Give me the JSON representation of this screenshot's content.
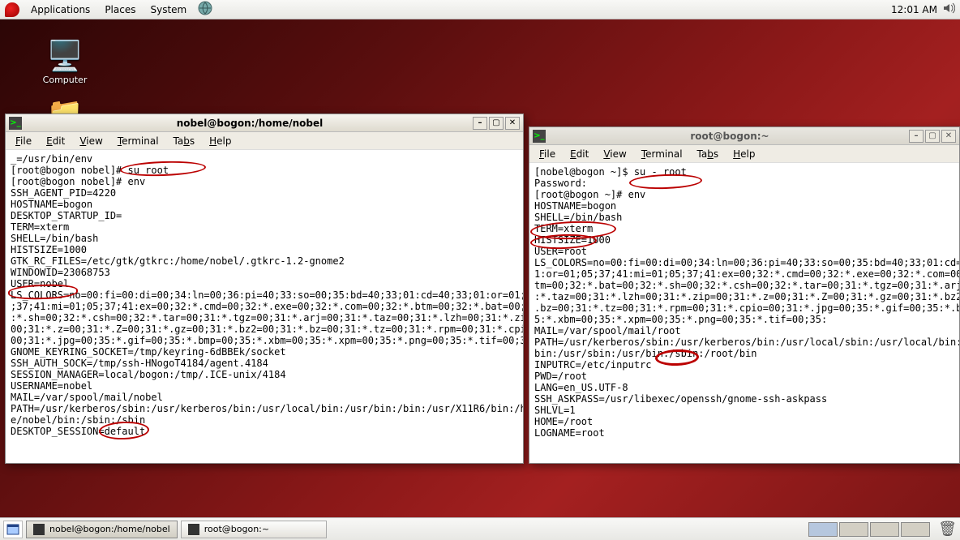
{
  "top_panel": {
    "menus": [
      "Applications",
      "Places",
      "System"
    ],
    "clock": "12:01 AM"
  },
  "desktop_icons": {
    "computer": "Computer",
    "home": ""
  },
  "window_left": {
    "title": "nobel@bogon:/home/nobel",
    "menubar": [
      "File",
      "Edit",
      "View",
      "Terminal",
      "Tabs",
      "Help"
    ],
    "content": "_=/usr/bin/env\n[root@bogon nobel]# su root\n[root@bogon nobel]# env\nSSH_AGENT_PID=4220\nHOSTNAME=bogon\nDESKTOP_STARTUP_ID=\nTERM=xterm\nSHELL=/bin/bash\nHISTSIZE=1000\nGTK_RC_FILES=/etc/gtk/gtkrc:/home/nobel/.gtkrc-1.2-gnome2\nWINDOWID=23068753\nUSER=nobel\nLS_COLORS=no=00:fi=00:di=00;34:ln=00;36:pi=40;33:so=00;35:bd=40;33;01:cd=40;33;01:or=01;05\n;37;41:mi=01;05;37;41:ex=00;32:*.cmd=00;32:*.exe=00;32:*.com=00;32:*.btm=00;32:*.bat=00;32\n:*.sh=00;32:*.csh=00;32:*.tar=00;31:*.tgz=00;31:*.arj=00;31:*.taz=00;31:*.lzh=00;31:*.zip=\n00;31:*.z=00;31:*.Z=00;31:*.gz=00;31:*.bz2=00;31:*.bz=00;31:*.tz=00;31:*.rpm=00;31:*.cpio=\n00;31:*.jpg=00;35:*.gif=00;35:*.bmp=00;35:*.xbm=00;35:*.xpm=00;35:*.png=00;35:*.tif=00;35:\nGNOME_KEYRING_SOCKET=/tmp/keyring-6dBBEk/socket\nSSH_AUTH_SOCK=/tmp/ssh-HNogoT4184/agent.4184\nSESSION_MANAGER=local/bogon:/tmp/.ICE-unix/4184\nUSERNAME=nobel\nMAIL=/var/spool/mail/nobel\nPATH=/usr/kerberos/sbin:/usr/kerberos/bin:/usr/local/bin:/usr/bin:/bin:/usr/X11R6/bin:/hom\ne/nobel/bin:/sbin:/sbin\nDESKTOP_SESSION=default"
  },
  "window_right": {
    "title": "root@bogon:~",
    "menubar": [
      "File",
      "Edit",
      "View",
      "Terminal",
      "Tabs",
      "Help"
    ],
    "content": "[nobel@bogon ~]$ su - root\nPassword:\n[root@bogon ~]# env\nHOSTNAME=bogon\nSHELL=/bin/bash\nTERM=xterm\nHISTSIZE=1000\nUSER=root\nLS_COLORS=no=00:fi=00:di=00;34:ln=00;36:pi=40;33:so=00;35:bd=40;33;01:cd=40;\n1:or=01;05;37;41:mi=01;05;37;41:ex=00;32:*.cmd=00;32:*.exe=00;32:*.com=00;32\ntm=00;32:*.bat=00;32:*.sh=00;32:*.csh=00;32:*.tar=00;31:*.tgz=00;31:*.arj=00\n:*.taz=00;31:*.lzh=00;31:*.zip=00;31:*.z=00;31:*.Z=00;31:*.gz=00;31:*.bz2=00;\n.bz=00;31:*.tz=00;31:*.rpm=00;31:*.cpio=00;31:*.jpg=00;35:*.gif=00;35:*.bmp=\n5:*.xbm=00;35:*.xpm=00;35:*.png=00;35:*.tif=00;35:\nMAIL=/var/spool/mail/root\nPATH=/usr/kerberos/sbin:/usr/kerberos/bin:/usr/local/sbin:/usr/local/bin:/sb\nbin:/usr/sbin:/usr/bin:/sbin:/root/bin\nINPUTRC=/etc/inputrc\nPWD=/root\nLANG=en_US.UTF-8\nSSH_ASKPASS=/usr/libexec/openssh/gnome-ssh-askpass\nSHLVL=1\nHOME=/root\nLOGNAME=root"
  },
  "taskbar": {
    "buttons": [
      "nobel@bogon:/home/nobel",
      "root@bogon:~"
    ]
  }
}
